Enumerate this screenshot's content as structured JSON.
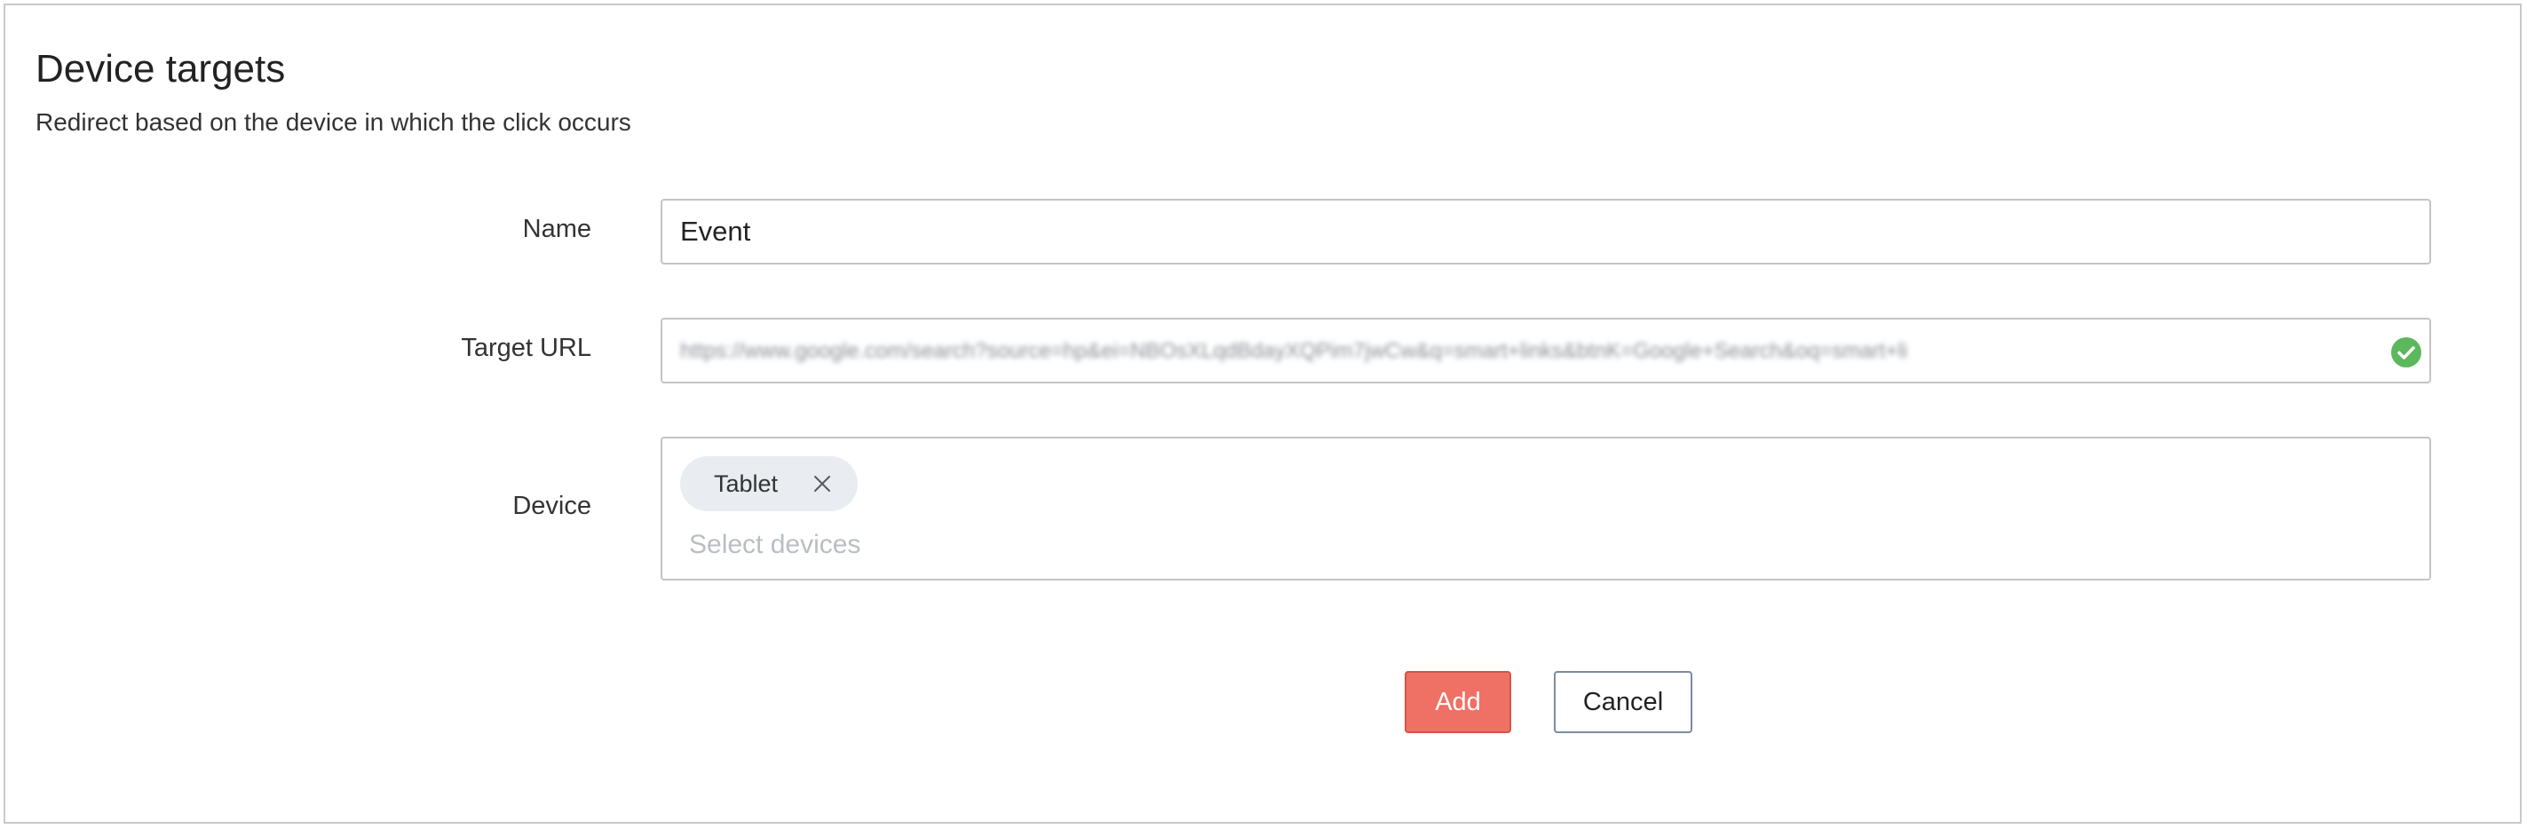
{
  "header": {
    "title": "Device targets",
    "subtitle": "Redirect based on the device in which the click occurs"
  },
  "form": {
    "name": {
      "label": "Name",
      "value": "Event"
    },
    "target_url": {
      "label": "Target URL",
      "value": "https://www.google.com/search?source=hp&ei=NBOsXLqdBdayXQPim7jwCw&q=smart+links&btnK=Google+Search&oq=smart+li",
      "status_icon": "check-circle-icon",
      "status_color": "#5cb85c"
    },
    "device": {
      "label": "Device",
      "selected": [
        {
          "label": "Tablet",
          "remove_icon": "close-icon"
        }
      ],
      "placeholder": "Select devices"
    }
  },
  "actions": {
    "add_label": "Add",
    "cancel_label": "Cancel",
    "accent_color": "#ef7064"
  }
}
